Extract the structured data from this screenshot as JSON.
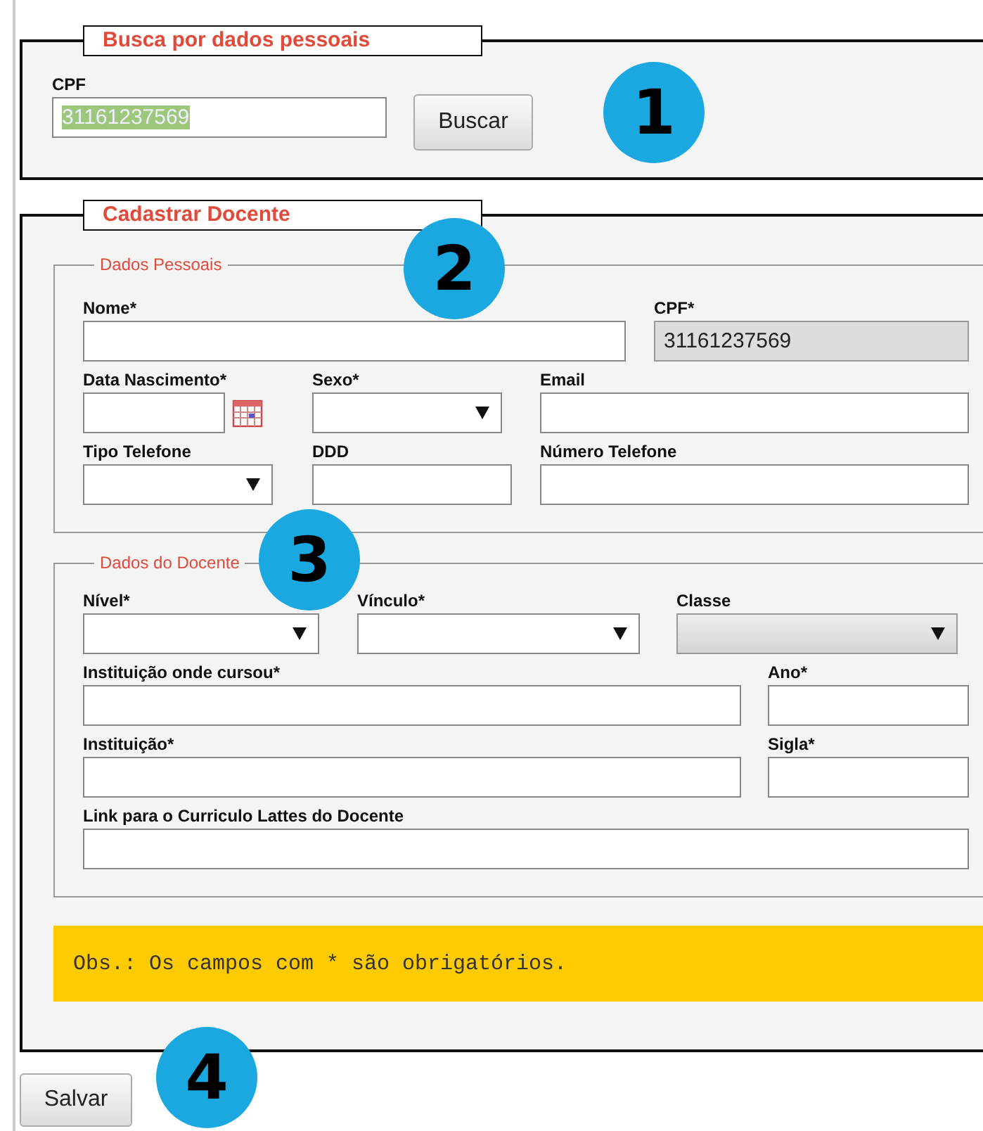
{
  "search_panel": {
    "legend": "Busca por dados pessoais",
    "field": {
      "label": "CPF",
      "kind": "text",
      "value": "31161237569",
      "highlighted": true,
      "disabled": false
    },
    "button": "Buscar"
  },
  "register_panel": {
    "legend": "Cadastrar Docente",
    "sections": [
      {
        "legend": "Dados Pessoais",
        "rows": [
          [
            {
              "label": "Nome*",
              "kind": "text",
              "disabled": false
            },
            {
              "label": "CPF*",
              "kind": "text",
              "value": "31161237569",
              "disabled": true
            }
          ],
          [
            {
              "label": "Data Nascimento*",
              "kind": "date",
              "disabled": false
            },
            {
              "label": "Sexo*",
              "kind": "select",
              "disabled": false
            },
            {
              "label": "Email",
              "kind": "text",
              "disabled": false
            }
          ],
          [
            {
              "label": "Tipo Telefone",
              "kind": "select",
              "disabled": false
            },
            {
              "label": "DDD",
              "kind": "text",
              "disabled": false
            },
            {
              "label": "Número Telefone",
              "kind": "text",
              "disabled": false
            }
          ]
        ]
      },
      {
        "legend": "Dados do Docente",
        "rows": [
          [
            {
              "label": "Nível*",
              "kind": "select",
              "disabled": false
            },
            {
              "label": "Vínculo*",
              "kind": "select",
              "disabled": false
            },
            {
              "label": "Classe",
              "kind": "select",
              "disabled": true
            }
          ],
          [
            {
              "label": "Instituição onde cursou*",
              "kind": "text",
              "disabled": false
            },
            {
              "label": "Ano*",
              "kind": "text",
              "disabled": false
            }
          ],
          [
            {
              "label": "Instituição*",
              "kind": "text",
              "disabled": false
            },
            {
              "label": "Sigla*",
              "kind": "text",
              "disabled": false
            }
          ],
          [
            {
              "label": "Link para o Curriculo Lattes do Docente",
              "kind": "text",
              "disabled": false
            }
          ]
        ]
      }
    ],
    "note": "Obs.: Os campos com * são obrigatórios."
  },
  "save_button": "Salvar",
  "callouts": [
    "1",
    "2",
    "3",
    "4"
  ]
}
